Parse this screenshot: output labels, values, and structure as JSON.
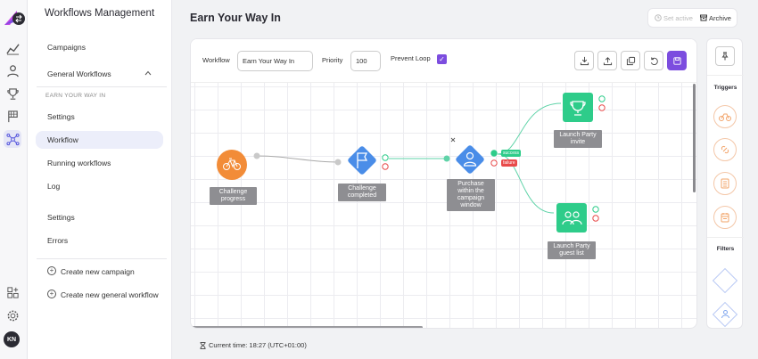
{
  "app": {
    "title": "Workflows Management",
    "user_initials": "KN"
  },
  "sidebar": {
    "campaigns": "Campaigns",
    "general_workflows": "General Workflows",
    "section_label": "EARN YOUR WAY IN",
    "items": [
      {
        "label": "Settings"
      },
      {
        "label": "Workflow",
        "active": true
      },
      {
        "label": "Running workflows"
      },
      {
        "label": "Log"
      }
    ],
    "bottom_items": [
      {
        "label": "Settings"
      },
      {
        "label": "Errors"
      }
    ],
    "create_campaign": "Create new campaign",
    "create_general_workflow": "Create new general workflow"
  },
  "header": {
    "page_title": "Earn Your Way In",
    "set_active": "Set active",
    "archive": "Archive"
  },
  "toolbar": {
    "workflow_label": "Workflow",
    "workflow_value": "Earn Your Way In",
    "priority_label": "Priority",
    "priority_value": "100",
    "prevent_loop_label": "Prevent Loop",
    "prevent_loop_checked": true
  },
  "nodes": {
    "challenge_progress": "Challenge progress",
    "challenge_completed": "Challenge completed",
    "purchase_window": "Purchase within the campaign window",
    "launch_party_invite": "Launch Party invite",
    "launch_party_guest_list": "Launch Party guest list",
    "success": "success",
    "failure": "failure"
  },
  "right_panel": {
    "triggers": "Triggers",
    "filters": "Filters"
  },
  "footer": {
    "current_time": "Current time: 18:27 (UTC+01:00)"
  },
  "colors": {
    "accent": "#7c4ddf",
    "trigger": "#f28c38",
    "filter": "#4a8de8",
    "action": "#2ecc8a",
    "failure": "#e84a4a"
  }
}
